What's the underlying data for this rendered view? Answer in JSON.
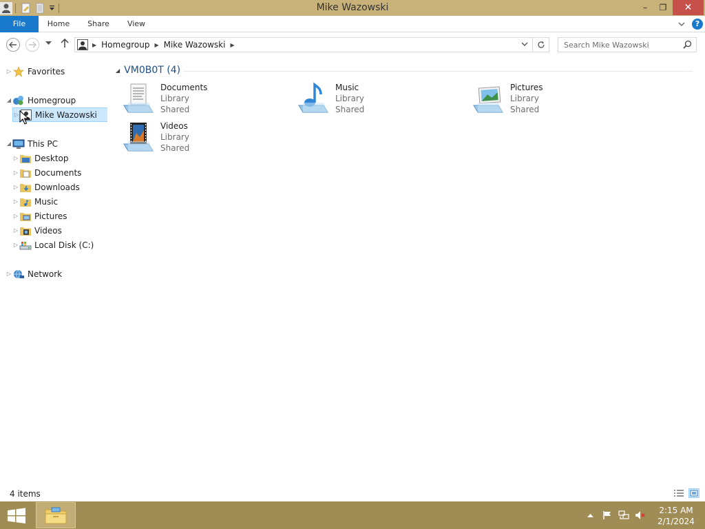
{
  "window": {
    "title": "Mike Wazowski",
    "minimize_glyph": "–",
    "maximize_glyph": "❐",
    "close_glyph": "✕"
  },
  "ribbon": {
    "tabs": [
      "File",
      "Home",
      "Share",
      "View"
    ],
    "expand_glyph": "⌄",
    "help_glyph": "?"
  },
  "address": {
    "breadcrumbs": [
      "Homegroup",
      "Mike Wazowski"
    ],
    "search_placeholder": "Search Mike Wazowski"
  },
  "nav_pane": {
    "favorites": "Favorites",
    "homegroup": "Homegroup",
    "homegroup_user": "Mike Wazowski",
    "this_pc": "This PC",
    "pc_items": [
      "Desktop",
      "Documents",
      "Downloads",
      "Music",
      "Pictures",
      "Videos",
      "Local Disk (C:)"
    ],
    "network": "Network"
  },
  "content": {
    "group_title": "VM0B0T (4)",
    "items": [
      {
        "name": "Documents",
        "type": "Library",
        "status": "Shared"
      },
      {
        "name": "Music",
        "type": "Library",
        "status": "Shared"
      },
      {
        "name": "Pictures",
        "type": "Library",
        "status": "Shared"
      },
      {
        "name": "Videos",
        "type": "Library",
        "status": "Shared"
      }
    ]
  },
  "status_bar": {
    "item_count": "4 items"
  },
  "taskbar": {
    "time": "2:15 AM",
    "date": "2/1/2024"
  },
  "colors": {
    "title_bar": "#c9b27a",
    "file_tab": "#1979ca",
    "selection": "#cce8ff",
    "taskbar": "#a08c55",
    "close_button": "#c7504b"
  },
  "icons": [
    "user-icon",
    "properties-icon",
    "new-folder-icon",
    "back-arrow-icon",
    "forward-arrow-icon",
    "up-arrow-icon",
    "refresh-icon",
    "search-icon",
    "star-icon",
    "homegroup-icon",
    "computer-icon",
    "folder-icon",
    "drive-icon",
    "network-icon",
    "library-icon",
    "windows-logo-icon",
    "flag-icon",
    "speaker-muted-icon"
  ]
}
